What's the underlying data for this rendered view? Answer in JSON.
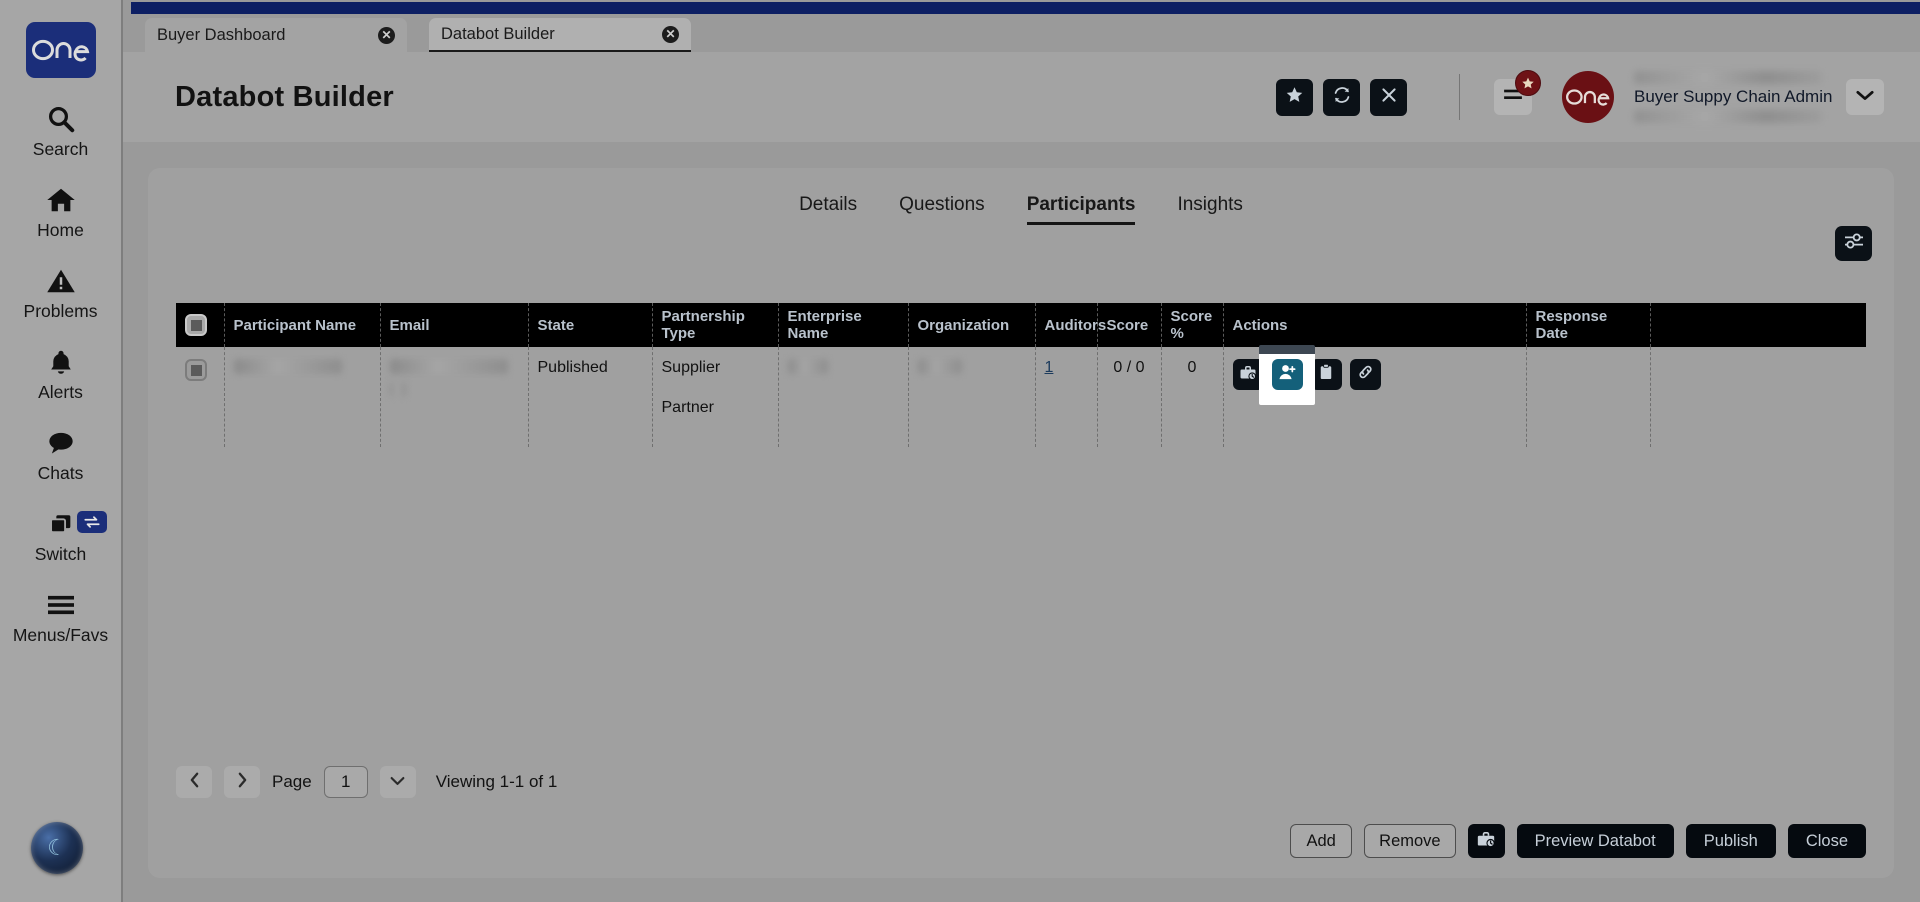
{
  "app": {
    "brand": "one",
    "accent_navy": "#1b2e7a",
    "accent_dark_red": "#6a1014",
    "accent_teal": "#14607a",
    "top_bar_color": "#0d1f63"
  },
  "sidebar": {
    "items": [
      {
        "label": "Search",
        "icon": "search-icon"
      },
      {
        "label": "Home",
        "icon": "home-icon"
      },
      {
        "label": "Problems",
        "icon": "warning-triangle-icon"
      },
      {
        "label": "Alerts",
        "icon": "bell-icon"
      },
      {
        "label": "Chats",
        "icon": "chat-bubble-icon"
      },
      {
        "label": "Switch",
        "icon": "windows-switch-icon",
        "badge_icon": "swap-arrows-icon"
      },
      {
        "label": "Menus/Favs",
        "icon": "hamburger-icon"
      }
    ]
  },
  "browser_tabs": [
    {
      "label": "Buyer Dashboard",
      "active": false,
      "close_icon": "close-circle-icon"
    },
    {
      "label": "Databot Builder",
      "active": true,
      "close_icon": "close-circle-icon"
    }
  ],
  "header": {
    "title": "Databot Builder",
    "actions": [
      {
        "name": "favorite-button",
        "icon": "star-icon"
      },
      {
        "name": "refresh-button",
        "icon": "refresh-icon"
      },
      {
        "name": "close-button",
        "icon": "x-icon"
      }
    ],
    "menu_icon": "hamburger-icon",
    "menu_badge_icon": "star-icon",
    "user": {
      "name_redacted": "",
      "role": "Buyer Suppy Chain Admin",
      "org_redacted": "",
      "caret_icon": "chevron-down-icon"
    }
  },
  "main": {
    "tabs": [
      {
        "label": "Details",
        "active": false
      },
      {
        "label": "Questions",
        "active": false
      },
      {
        "label": "Participants",
        "active": true
      },
      {
        "label": "Insights",
        "active": false
      }
    ],
    "grid_settings_icon": "sliders-icon",
    "table": {
      "columns": [
        {
          "key": "select",
          "label": ""
        },
        {
          "key": "participant_name",
          "label": "Participant Name"
        },
        {
          "key": "email",
          "label": "Email"
        },
        {
          "key": "state",
          "label": "State"
        },
        {
          "key": "partnership_type",
          "label": "Partnership Type"
        },
        {
          "key": "enterprise_name",
          "label": "Enterprise Name"
        },
        {
          "key": "organization",
          "label": "Organization"
        },
        {
          "key": "auditors",
          "label": "Auditors"
        },
        {
          "key": "score",
          "label": "Score"
        },
        {
          "key": "score_pct",
          "label": "Score %"
        },
        {
          "key": "actions",
          "label": "Actions"
        },
        {
          "key": "response_date",
          "label": "Response Date"
        },
        {
          "key": "spacer",
          "label": ""
        }
      ],
      "rows": [
        {
          "participant_name": "",
          "email": "",
          "state": "Published",
          "partnership_type_line1": "Supplier",
          "partnership_type_line2": "Partner",
          "enterprise_name": "",
          "organization": "",
          "auditors": "1",
          "score": "0 / 0",
          "score_pct": "0",
          "response_date": "",
          "actions": [
            {
              "name": "audit-history-button",
              "icon": "briefcase-clock-icon",
              "active": false
            },
            {
              "name": "add-participant-button",
              "icon": "user-plus-icon",
              "active": true
            },
            {
              "name": "copy-button",
              "icon": "clipboard-icon",
              "active": false
            },
            {
              "name": "link-button",
              "icon": "link-icon",
              "active": false
            }
          ]
        }
      ]
    },
    "pagination": {
      "prev_icon": "chevron-left-icon",
      "next_icon": "chevron-right-icon",
      "page_label": "Page",
      "page_value": "1",
      "dropdown_icon": "chevron-down-icon",
      "viewing": "Viewing 1-1 of 1"
    },
    "footer_buttons": [
      {
        "name": "add-button",
        "label": "Add",
        "style": "outline"
      },
      {
        "name": "remove-button",
        "label": "Remove",
        "style": "outline"
      },
      {
        "name": "schedule-button",
        "label": "",
        "style": "icon-dark",
        "icon": "briefcase-clock-icon"
      },
      {
        "name": "preview-databot-button",
        "label": "Preview Databot",
        "style": "dark"
      },
      {
        "name": "publish-button",
        "label": "Publish",
        "style": "dark"
      },
      {
        "name": "close-button",
        "label": "Close",
        "style": "dark"
      }
    ]
  }
}
